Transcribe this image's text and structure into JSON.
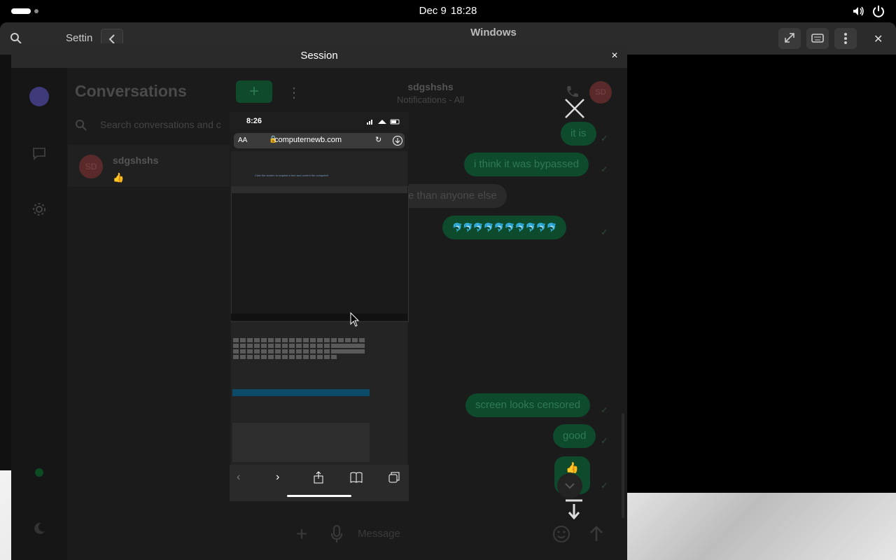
{
  "topbar": {
    "date": "Dec 9",
    "time": "18:28"
  },
  "background_window": {
    "sidebar_title": "Settin",
    "title": "Windows"
  },
  "session": {
    "title": "Session",
    "close_glyph": "×"
  },
  "chat_app": {
    "conversations_title": "Conversations",
    "new_button": "+",
    "search_placeholder": "Search conversations and c",
    "conversation": {
      "avatar": "SD",
      "name": "sdgshshs",
      "preview": "👍"
    },
    "header": {
      "name": "sdgshshs",
      "subtitle": "Notifications - All",
      "avatar": "SD"
    },
    "messages": [
      {
        "text": "it is",
        "outgoing": true
      },
      {
        "text": "i think it was bypassed",
        "outgoing": true
      },
      {
        "text": "re than anyone else",
        "outgoing": false
      },
      {
        "text": "🐬🐬🐬🐬🐬🐬🐬🐬🐬🐬",
        "outgoing": true
      },
      {
        "text": "screen looks censored",
        "outgoing": true
      },
      {
        "text": "good",
        "outgoing": true
      },
      {
        "text": "👍",
        "outgoing": true
      }
    ],
    "composer_placeholder": "Message"
  },
  "phone_screenshot": {
    "time": "8:26",
    "url": "computernewb.com",
    "reader_label": "AA",
    "page_hint": "Click the screen to request a turn and control the computer!"
  },
  "icons": {
    "volume": "volume-icon",
    "power": "power-icon",
    "search": "search-icon"
  },
  "colors": {
    "accent_green": "#0e4a2c",
    "header_bg": "#2a2a2a"
  }
}
